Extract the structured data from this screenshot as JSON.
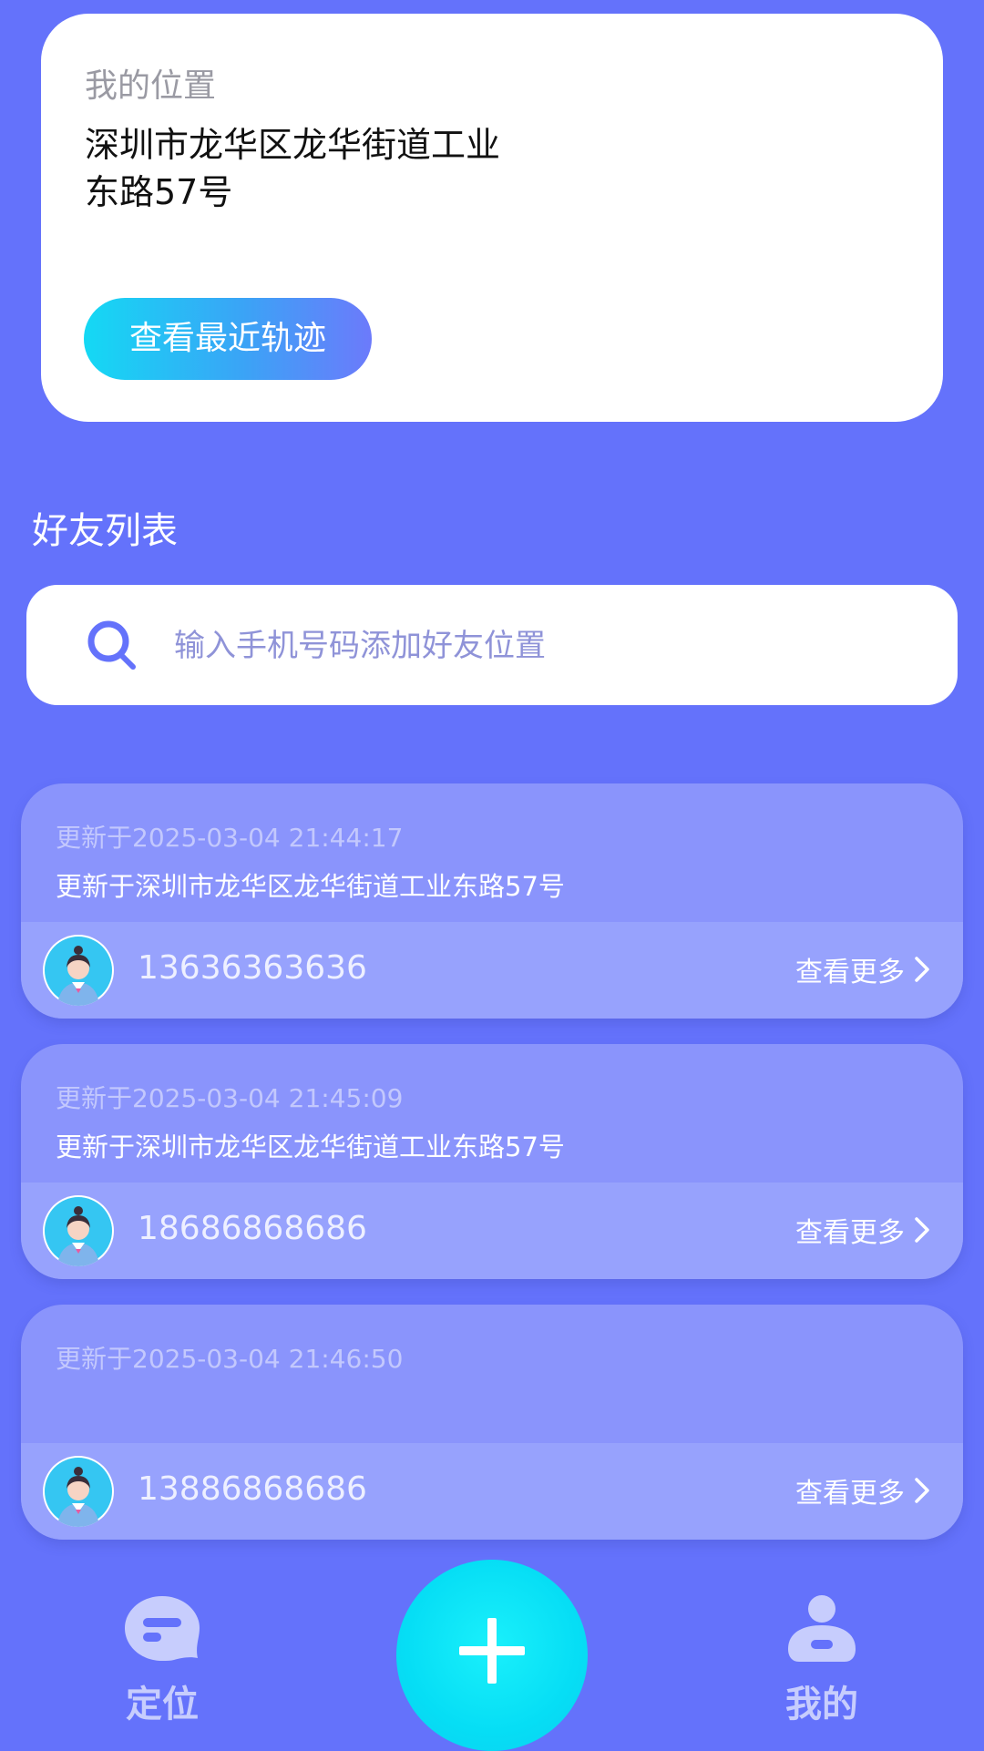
{
  "location_card": {
    "label": "我的位置",
    "address": "深圳市龙华区龙华街道工业东路57号",
    "track_button_label": "查看最近轨迹"
  },
  "friends_section": {
    "title": "好友列表",
    "search_placeholder": "输入手机号码添加好友位置"
  },
  "friends": [
    {
      "updated_time": "更新于2025-03-04 21:44:17",
      "address": "更新于深圳市龙华区龙华街道工业东路57号",
      "phone": "13636363636",
      "more_label": "查看更多"
    },
    {
      "updated_time": "更新于2025-03-04 21:45:09",
      "address": "更新于深圳市龙华区龙华街道工业东路57号",
      "phone": "18686868686",
      "more_label": "查看更多"
    },
    {
      "updated_time": "更新于2025-03-04 21:46:50",
      "address": "",
      "phone": "13886868686",
      "more_label": "查看更多"
    }
  ],
  "bottom_nav": {
    "left_label": "定位",
    "right_label": "我的",
    "left_icon": "chat-bubble-icon",
    "center_icon": "plus-icon",
    "right_icon": "user-icon"
  },
  "colors": {
    "background": "#6472fb",
    "card_top": "#8a94fc",
    "card_bottom": "#97a2fd",
    "fab": "#06def5",
    "nav_label": "#c7cdfd"
  }
}
